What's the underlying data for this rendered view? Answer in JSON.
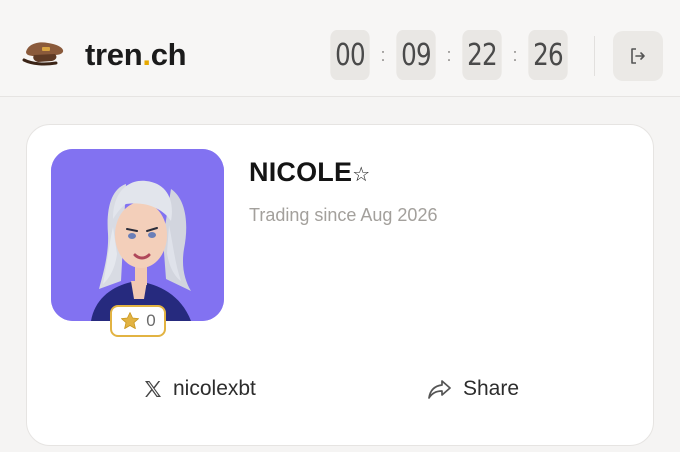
{
  "header": {
    "logo_icon": "pilot-cap-icon",
    "brand_prefix": "tren",
    "brand_dot": ".",
    "brand_suffix": "ch",
    "brand_accent": "#e6a800",
    "timer": [
      "00",
      "09",
      "22",
      "26"
    ],
    "timer_separator": ":",
    "logout_icon": "logout-icon"
  },
  "profile": {
    "name": "NICOLE",
    "name_suffix_icon": "star-outline-icon",
    "name_suffix_glyph": "☆",
    "since": "Trading since Aug 2026",
    "avatar_bg": "#8272f1",
    "star_count": "0",
    "star_color": "#e2b342"
  },
  "actions": {
    "x_handle": "nicolexbt",
    "share_label": "Share"
  }
}
